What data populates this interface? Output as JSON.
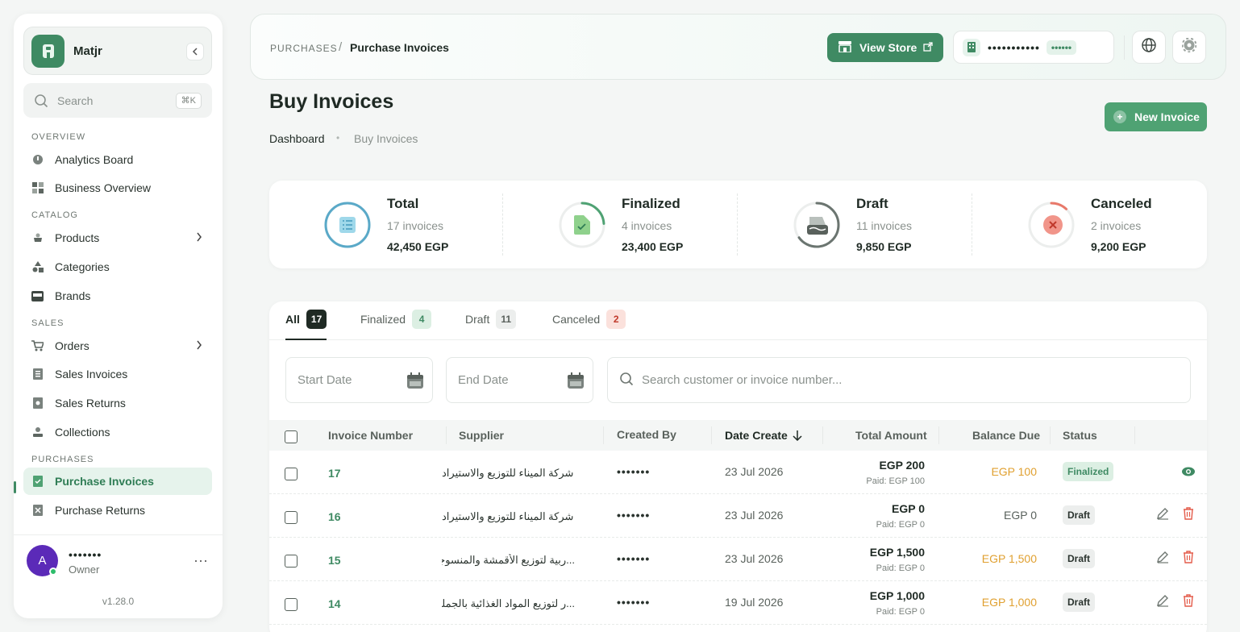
{
  "app": {
    "name": "Matjr",
    "search_placeholder": "Search",
    "search_shortcut": "⌘K",
    "version": "v1.28.0"
  },
  "sidebar": {
    "sections": {
      "overview": "OVERVIEW",
      "catalog": "CATALOG",
      "sales": "SALES",
      "purchases": "PURCHASES"
    },
    "items": [
      {
        "label": "Analytics Board",
        "icon": "gauge-icon"
      },
      {
        "label": "Business Overview",
        "icon": "grid-icon"
      },
      {
        "label": "Products",
        "icon": "product-icon",
        "expandable": true
      },
      {
        "label": "Categories",
        "icon": "shapes-icon"
      },
      {
        "label": "Brands",
        "icon": "brand-icon"
      },
      {
        "label": "Orders",
        "icon": "cart-icon",
        "expandable": true
      },
      {
        "label": "Sales Invoices",
        "icon": "invoice-icon"
      },
      {
        "label": "Sales Returns",
        "icon": "return-icon"
      },
      {
        "label": "Collections",
        "icon": "collection-icon"
      },
      {
        "label": "Purchase Invoices",
        "icon": "purchase-invoice-icon",
        "active": true
      },
      {
        "label": "Purchase Returns",
        "icon": "purchase-return-icon"
      }
    ],
    "user": {
      "initial": "A",
      "name": "•••••••",
      "role": "Owner"
    }
  },
  "header": {
    "breadcrumb_section": "PURCHASES",
    "breadcrumb_current": "Purchase Invoices",
    "view_store": "View Store",
    "store_name": "•••••••••••",
    "store_tag": "••••••"
  },
  "page": {
    "title": "Buy Invoices",
    "crumb_home": "Dashboard",
    "crumb_current": "Buy Invoices",
    "new_button": "New Invoice"
  },
  "stats": [
    {
      "label": "Total",
      "count": "17 invoices",
      "amount": "42,450 EGP",
      "color": "#5aa9c8",
      "progress": 1.0
    },
    {
      "label": "Finalized",
      "count": "4 invoices",
      "amount": "23,400 EGP",
      "color": "#4fa273",
      "progress": 0.24
    },
    {
      "label": "Draft",
      "count": "11 invoices",
      "amount": "9,850 EGP",
      "color": "#6b7570",
      "progress": 0.65
    },
    {
      "label": "Canceled",
      "count": "2 invoices",
      "amount": "9,200 EGP",
      "color": "#e8796a",
      "progress": 0.12
    }
  ],
  "tabs": [
    {
      "label": "All",
      "count": "17"
    },
    {
      "label": "Finalized",
      "count": "4"
    },
    {
      "label": "Draft",
      "count": "11"
    },
    {
      "label": "Canceled",
      "count": "2"
    }
  ],
  "filters": {
    "start_date": "Start Date",
    "end_date": "End Date",
    "search_placeholder": "Search customer or invoice number..."
  },
  "table": {
    "columns": [
      "Invoice Number",
      "Supplier",
      "Created By",
      "Date Create",
      "Total Amount",
      "Balance Due",
      "Status"
    ],
    "rows": [
      {
        "number": "17",
        "supplier": "شركة الميناء للتوزيع والاستيراد",
        "created_by": "•••••••",
        "date": "23 Jul 2026",
        "total": "EGP 200",
        "paid": "Paid: EGP 100",
        "balance": "EGP 100",
        "status": "Finalized"
      },
      {
        "number": "16",
        "supplier": "شركة الميناء للتوزيع والاستيراد",
        "created_by": "•••••••",
        "date": "23 Jul 2026",
        "total": "EGP 0",
        "paid": "Paid: EGP 0",
        "balance": "EGP 0",
        "status": "Draft"
      },
      {
        "number": "15",
        "supplier": "...ربية لتوزيع الأقمشة والمنسوجات",
        "created_by": "•••••••",
        "date": "23 Jul 2026",
        "total": "EGP 1,500",
        "paid": "Paid: EGP 0",
        "balance": "EGP 1,500",
        "status": "Draft"
      },
      {
        "number": "14",
        "supplier": "...ر لتوزيع المواد الغذائية بالجملة",
        "created_by": "•••••••",
        "date": "19 Jul 2026",
        "total": "EGP 1,000",
        "paid": "Paid: EGP 0",
        "balance": "EGP 1,000",
        "status": "Draft"
      }
    ]
  }
}
